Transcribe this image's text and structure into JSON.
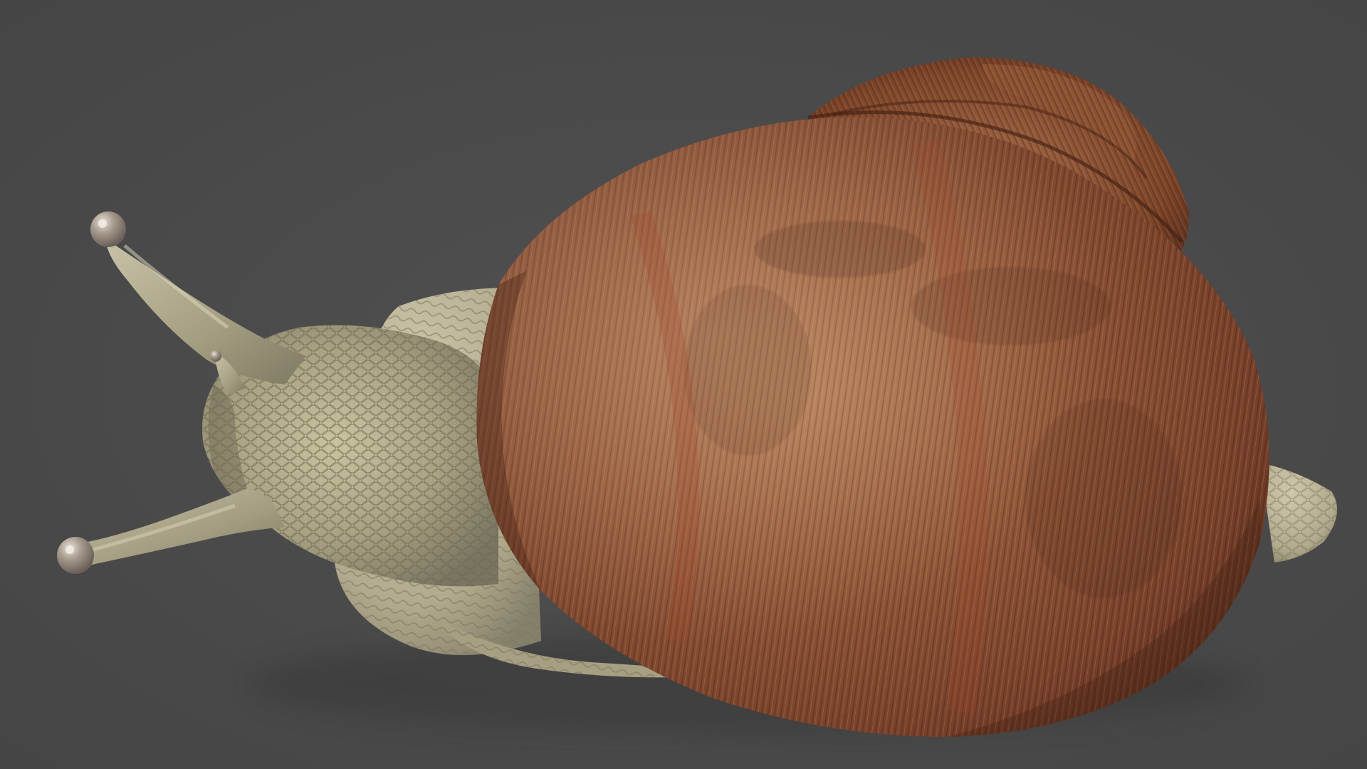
{
  "scene": {
    "subject": "snail",
    "background_color": "#4a4a4a",
    "colors": {
      "shell_primary": "#8a4f2f",
      "shell_highlight": "#b88660",
      "shell_dark": "#5a2f1a",
      "body_primary": "#b9b391",
      "body_dark": "#7f7a5f",
      "tentacle": "#a8a287",
      "eye_tip": "#a59a8e"
    }
  }
}
